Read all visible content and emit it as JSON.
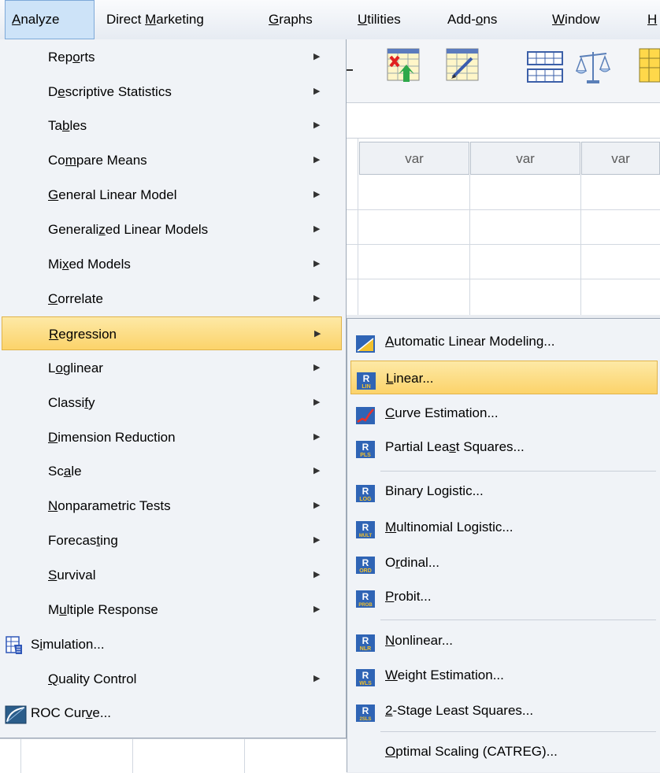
{
  "menubar": {
    "items": [
      {
        "pre": "",
        "ul": "A",
        "post": "nalyze"
      },
      {
        "pre": "Direct ",
        "ul": "M",
        "post": "arketing"
      },
      {
        "pre": "",
        "ul": "G",
        "post": "raphs"
      },
      {
        "pre": "",
        "ul": "U",
        "post": "tilities"
      },
      {
        "pre": "Add-",
        "ul": "o",
        "post": "ns"
      },
      {
        "pre": "",
        "ul": "W",
        "post": "indow"
      },
      {
        "pre": "",
        "ul": "H",
        "post": ""
      }
    ]
  },
  "grid": {
    "column_headers": [
      "var",
      "var",
      "var"
    ]
  },
  "analyze_menu": {
    "items": [
      {
        "pre": "Rep",
        "ul": "o",
        "post": "rts"
      },
      {
        "pre": "D",
        "ul": "e",
        "post": "scriptive Statistics"
      },
      {
        "pre": "Ta",
        "ul": "b",
        "post": "les"
      },
      {
        "pre": "Co",
        "ul": "m",
        "post": "pare Means"
      },
      {
        "pre": "",
        "ul": "G",
        "post": "eneral Linear Model"
      },
      {
        "pre": "Generali",
        "ul": "z",
        "post": "ed Linear Models"
      },
      {
        "pre": "Mi",
        "ul": "x",
        "post": "ed Models"
      },
      {
        "pre": "",
        "ul": "C",
        "post": "orrelate"
      },
      {
        "pre": "",
        "ul": "R",
        "post": "egression"
      },
      {
        "pre": "L",
        "ul": "o",
        "post": "glinear"
      },
      {
        "pre": "Classi",
        "ul": "f",
        "post": "y"
      },
      {
        "pre": "",
        "ul": "D",
        "post": "imension Reduction"
      },
      {
        "pre": "Sc",
        "ul": "a",
        "post": "le"
      },
      {
        "pre": "",
        "ul": "N",
        "post": "onparametric Tests"
      },
      {
        "pre": "Forecas",
        "ul": "t",
        "post": "ing"
      },
      {
        "pre": "",
        "ul": "S",
        "post": "urvival"
      },
      {
        "pre": "M",
        "ul": "u",
        "post": "ltiple Response"
      },
      {
        "pre": "S",
        "ul": "i",
        "post": "mulation..."
      },
      {
        "pre": "",
        "ul": "Q",
        "post": "uality Control"
      },
      {
        "pre": "ROC Cur",
        "ul": "v",
        "post": "e..."
      }
    ]
  },
  "regression_submenu": {
    "items": [
      {
        "pre": "",
        "ul": "A",
        "post": "utomatic Linear Modeling...",
        "icon": "automatic-linear-modeling-icon"
      },
      {
        "pre": "",
        "ul": "L",
        "post": "inear...",
        "icon": "linear-regression-icon",
        "badge": "LIN"
      },
      {
        "pre": "",
        "ul": "C",
        "post": "urve Estimation...",
        "icon": "curve-estimation-icon"
      },
      {
        "pre": "Partial Lea",
        "ul": "s",
        "post": "t Squares...",
        "icon": "partial-least-squares-icon",
        "badge": "PLS"
      },
      {
        "pre": "Binary Lo",
        "ul": "g",
        "post": "istic...",
        "icon": "binary-logistic-icon",
        "badge": "LOG"
      },
      {
        "pre": "",
        "ul": "M",
        "post": "ultinomial Logistic...",
        "icon": "multinomial-logistic-icon",
        "badge": "MULT"
      },
      {
        "pre": "O",
        "ul": "r",
        "post": "dinal...",
        "icon": "ordinal-regression-icon",
        "badge": "ORD"
      },
      {
        "pre": "",
        "ul": "P",
        "post": "robit...",
        "icon": "probit-icon",
        "badge": "PROB"
      },
      {
        "pre": "",
        "ul": "N",
        "post": "onlinear...",
        "icon": "nonlinear-regression-icon",
        "badge": "NLR"
      },
      {
        "pre": "",
        "ul": "W",
        "post": "eight Estimation...",
        "icon": "weight-estimation-icon",
        "badge": "WLS"
      },
      {
        "pre": "",
        "ul": "2",
        "post": "-Stage Least Squares...",
        "icon": "two-stage-least-squares-icon",
        "badge": "2SLS"
      },
      {
        "pre": "",
        "ul": "O",
        "post": "ptimal Scaling (CATREG)...",
        "icon": ""
      }
    ]
  },
  "colors": {
    "highlight_top": "#fde9a6",
    "highlight_bottom": "#fcd36a",
    "menu_bg": "#f0f3f7",
    "active_menubar": "#cde3f8"
  }
}
